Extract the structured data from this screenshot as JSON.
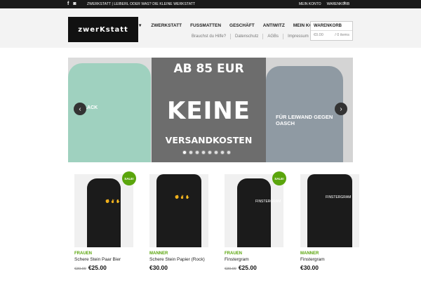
{
  "topbar": {
    "tagline": "ZWERKSTATT | LEIBERL ODER WAS? DIE KLEINE WERKSTATT",
    "links": [
      "MEIN KONTO",
      "WARENKORB"
    ],
    "social_icons": [
      "facebook-icon",
      "instagram-icon"
    ],
    "search_icon": "search-icon"
  },
  "logo": {
    "text": "zwerKstatt"
  },
  "nav": {
    "items": [
      {
        "label": "▾",
        "id": "shop"
      },
      {
        "label": "ZWERKSTATT",
        "id": "zwerkstatt"
      },
      {
        "label": "FUSSMATTEN",
        "id": "fussmatten"
      },
      {
        "label": "GESCHÄFT",
        "id": "geschaeft"
      },
      {
        "label": "ANTIWITZ",
        "id": "antiwitz"
      },
      {
        "label": "MEIN KONTO ▾",
        "id": "mein-konto"
      }
    ],
    "subnav": [
      "Brauchst du Hilfe?",
      "Datenschutz",
      "AGBs",
      "Impressum"
    ]
  },
  "cart": {
    "title": "WARENKORB",
    "total": "€0.00",
    "items": "/ 0 items"
  },
  "slider": {
    "line1": "AB 85 EUR",
    "line2": "KEINE",
    "line3": "VERSANDKOSTEN",
    "left_shirt_text": "SCHLACK",
    "right_shirt_text": "FÜR LEIWAND GEGEN OASCH",
    "dot_count": 8,
    "active_dot": 0
  },
  "products": [
    {
      "category": "FRAUEN",
      "name": "Schere Stein Paar Bier",
      "old_price": "€30.00",
      "price": "€25.00",
      "sale": "SALE!",
      "type": "tank",
      "print": "✊ ✌ ✋"
    },
    {
      "category": "MANNER",
      "name": "Schere Stein Papier (Rock)",
      "old_price": "",
      "price": "€30.00",
      "sale": "",
      "type": "tee",
      "print": "✊ ✌ ✋"
    },
    {
      "category": "FRAUEN",
      "name": "Finstergram",
      "old_price": "€30.00",
      "price": "€25.00",
      "sale": "SALE!",
      "type": "tank",
      "print": "FINSTERGRAM"
    },
    {
      "category": "MANNER",
      "name": "Finstergram",
      "old_price": "",
      "price": "€30.00",
      "sale": "",
      "type": "tee",
      "print": "FINSTERGRAM"
    }
  ],
  "colors": {
    "accent": "#5aa50c",
    "topbar": "#1a1a1a"
  }
}
